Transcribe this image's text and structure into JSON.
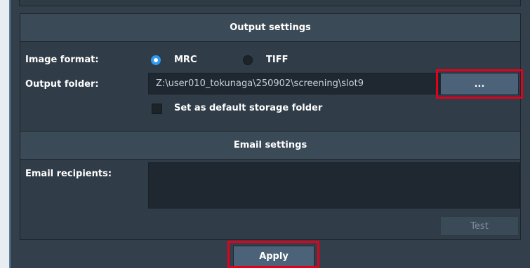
{
  "output_settings": {
    "title": "Output settings",
    "image_format_label": "Image format:",
    "formats": [
      {
        "label": "MRC",
        "selected": true
      },
      {
        "label": "TIFF",
        "selected": false
      }
    ],
    "output_folder_label": "Output folder:",
    "output_folder_value": "Z:\\user010_tokunaga\\250902\\screening\\slot9",
    "browse_label": "...",
    "default_storage_label": "Set as default storage folder",
    "default_storage_checked": false
  },
  "email_settings": {
    "title": "Email settings",
    "recipients_label": "Email recipients:",
    "recipients_value": "",
    "test_label": "Test"
  },
  "footer": {
    "apply_label": "Apply"
  },
  "colors": {
    "panel_bg": "#33404b",
    "header_bg": "#3b4a57",
    "field_bg": "#1f2830",
    "accent": "#2e9bf0",
    "button_bg": "#4b6278",
    "highlight": "#e3001b"
  }
}
